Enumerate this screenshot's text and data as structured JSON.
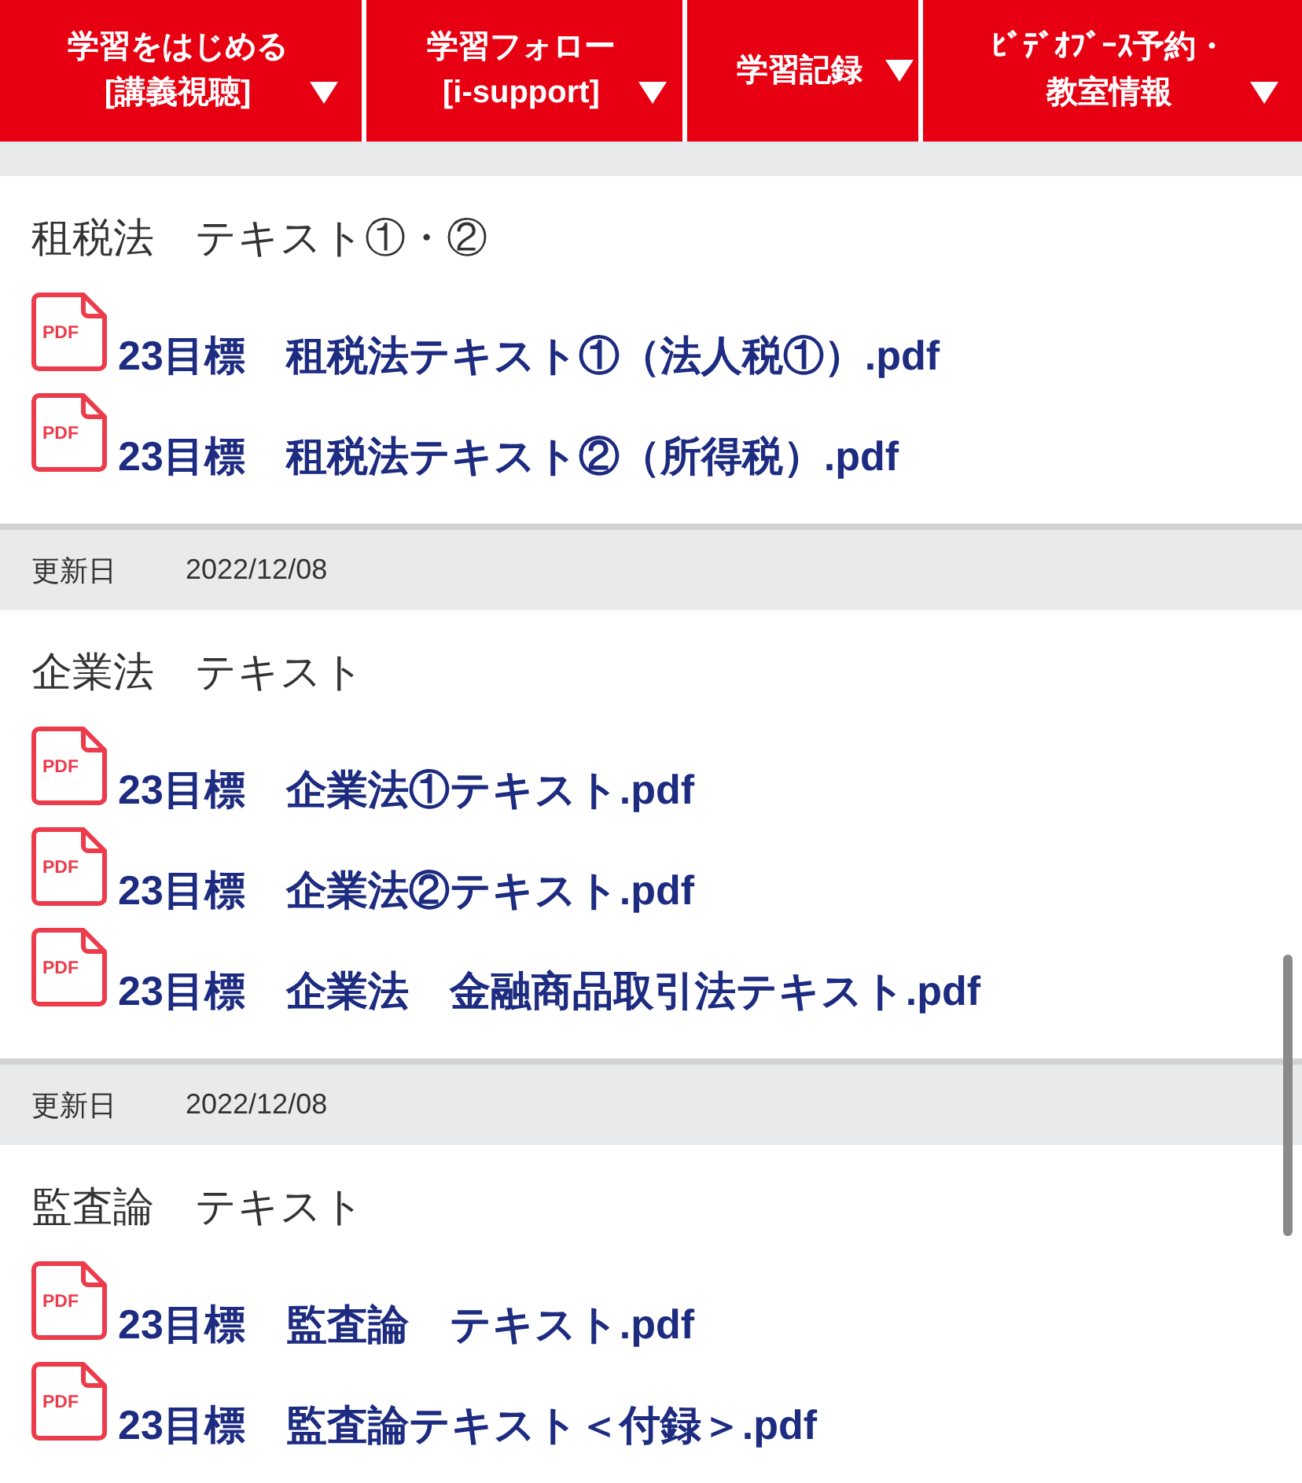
{
  "nav": {
    "items": [
      {
        "lines": [
          "学習をはじめる",
          "[講義視聴]"
        ]
      },
      {
        "lines": [
          "学習フォロー",
          "[i-support]"
        ]
      },
      {
        "lines": [
          "学習記録"
        ]
      },
      {
        "lines": [
          "ﾋﾞﾃﾞｵﾌﾞｰｽ予約・",
          "教室情報"
        ]
      }
    ]
  },
  "sections": [
    {
      "title": "租税法　テキスト①・②",
      "files": [
        {
          "icon_label": "PDF",
          "name": "23目標　租税法テキスト①（法人税①）.pdf"
        },
        {
          "icon_label": "PDF",
          "name": "23目標　租税法テキスト②（所得税）.pdf"
        }
      ]
    },
    {
      "updated": {
        "label": "更新日",
        "date": "2022/12/08"
      },
      "title": "企業法　テキスト",
      "files": [
        {
          "icon_label": "PDF",
          "name": "23目標　企業法①テキスト.pdf"
        },
        {
          "icon_label": "PDF",
          "name": "23目標　企業法②テキスト.pdf"
        },
        {
          "icon_label": "PDF",
          "name": "23目標　企業法　金融商品取引法テキスト.pdf"
        }
      ]
    },
    {
      "updated": {
        "label": "更新日",
        "date": "2022/12/08"
      },
      "title": "監査論　テキスト",
      "files": [
        {
          "icon_label": "PDF",
          "name": "23目標　監査論　テキスト.pdf"
        },
        {
          "icon_label": "PDF",
          "name": "23目標　監査論テキスト＜付録＞.pdf"
        }
      ]
    }
  ]
}
